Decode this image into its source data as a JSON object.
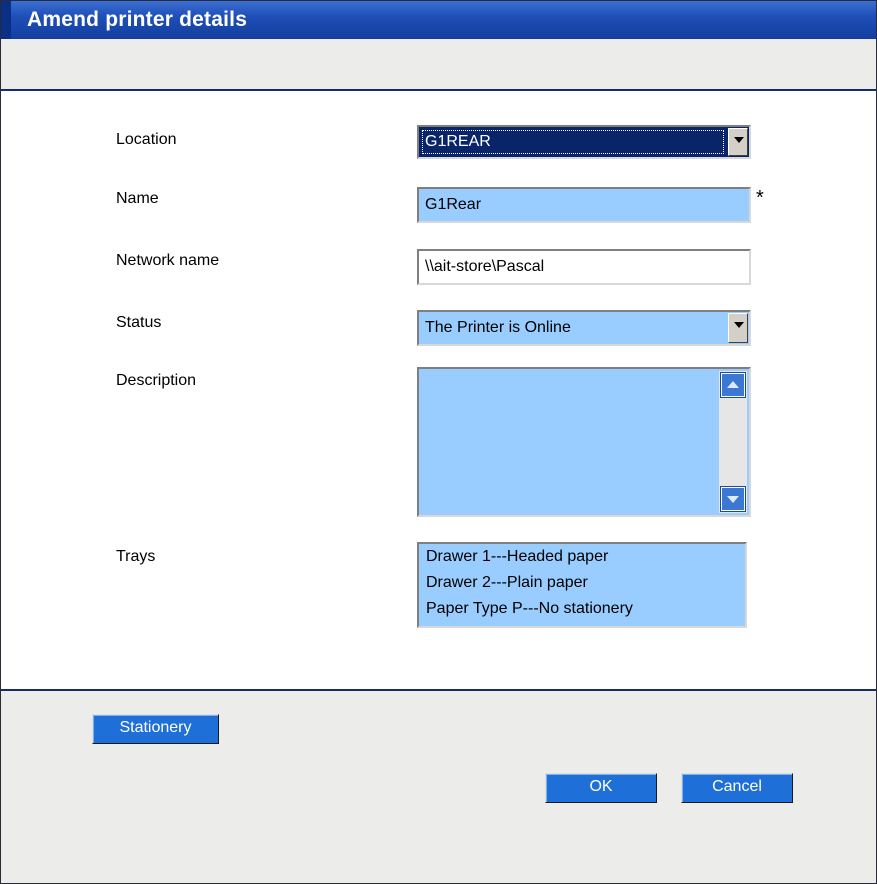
{
  "window": {
    "title": "Amend printer details"
  },
  "form": {
    "location": {
      "label": "Location",
      "value": "G1REAR"
    },
    "name": {
      "label": "Name",
      "value": "G1Rear",
      "required_mark": "*"
    },
    "network_name": {
      "label": "Network name",
      "value": "\\\\ait-store\\Pascal"
    },
    "status": {
      "label": "Status",
      "value": "The Printer is Online"
    },
    "description": {
      "label": "Description",
      "value": ""
    },
    "trays": {
      "label": "Trays",
      "options": [
        "Drawer 1---Headed paper",
        "Drawer 2---Plain paper",
        "Paper Type P---No stationery"
      ]
    }
  },
  "footer": {
    "stationery_label": "Stationery",
    "ok_label": "OK",
    "cancel_label": "Cancel"
  },
  "colors": {
    "title_bar": "#1f4fb8",
    "field_bg": "#99ccff",
    "button_bg": "#1f6fd8",
    "panel_bg": "#ececea"
  },
  "icons": {
    "dropdown": "chevron-down-icon",
    "scroll_up": "scroll-up-icon",
    "scroll_down": "scroll-down-icon"
  }
}
